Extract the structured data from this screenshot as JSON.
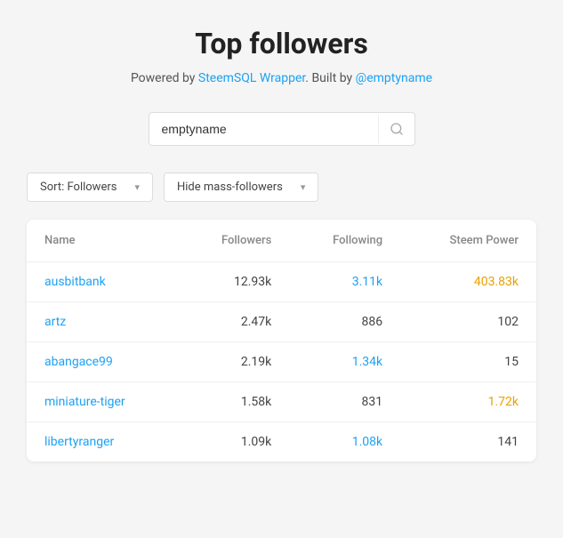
{
  "page": {
    "title": "Top followers",
    "subtitle_text": "Powered by ",
    "steemSQL_label": "SteemSQL Wrapper",
    "steemSQL_href": "#",
    "built_by_text": ". Built by ",
    "author_label": "@emptyname",
    "author_href": "#"
  },
  "search": {
    "value": "emptyname",
    "placeholder": "emptyname",
    "button_icon": "🔍"
  },
  "filters": {
    "sort_label": "Sort: Followers",
    "mass_label": "Hide mass-followers"
  },
  "table": {
    "headers": {
      "name": "Name",
      "followers": "Followers",
      "following": "Following",
      "steem_power": "Steem Power"
    },
    "rows": [
      {
        "name": "ausbitbank",
        "followers": "12.93k",
        "following": "3.11k",
        "steem_power": "403.83k",
        "sp_color": "orange"
      },
      {
        "name": "artz",
        "followers": "2.47k",
        "following": "886",
        "steem_power": "102",
        "sp_color": "normal"
      },
      {
        "name": "abangace99",
        "followers": "2.19k",
        "following": "1.34k",
        "steem_power": "15",
        "sp_color": "normal"
      },
      {
        "name": "miniature-tiger",
        "followers": "1.58k",
        "following": "831",
        "steem_power": "1.72k",
        "sp_color": "orange"
      },
      {
        "name": "libertyranger",
        "followers": "1.09k",
        "following": "1.08k",
        "steem_power": "141",
        "sp_color": "normal"
      }
    ]
  }
}
